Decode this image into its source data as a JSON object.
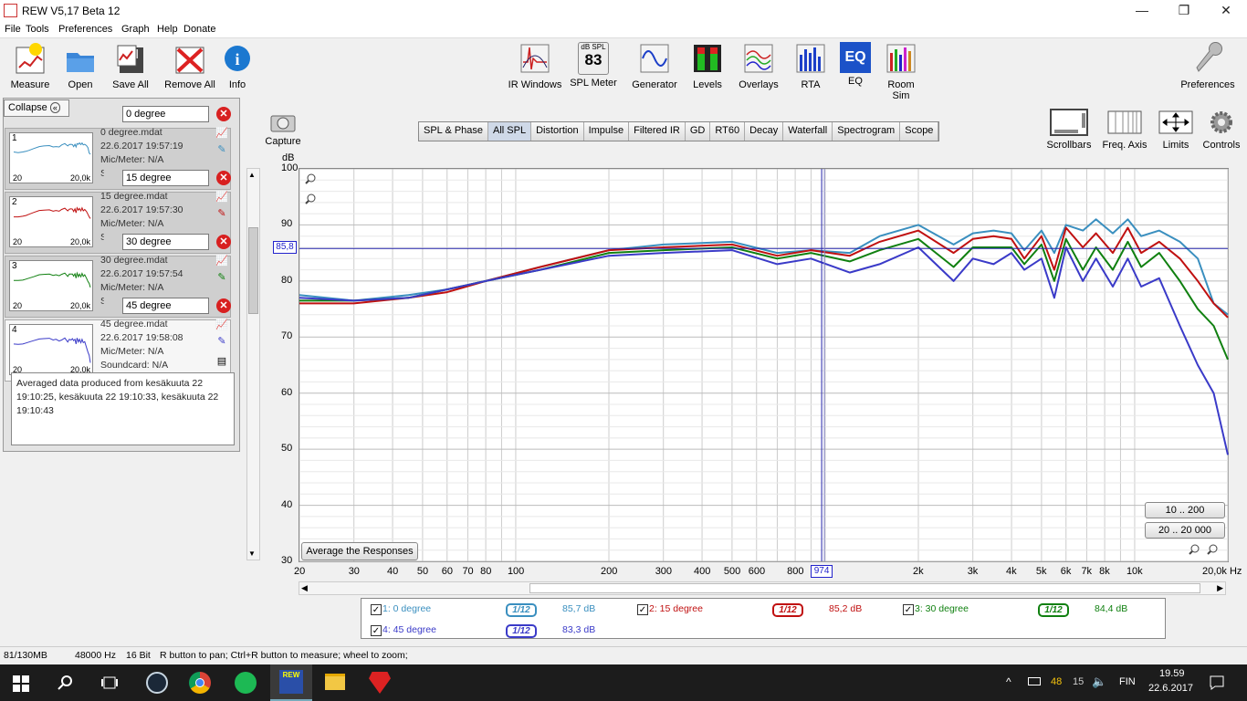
{
  "window": {
    "title": "REW V5,17 Beta 12",
    "min": "—",
    "max": "❐",
    "close": "✕"
  },
  "menu": [
    "File",
    "Tools",
    "Preferences",
    "Graph",
    "Help",
    "Donate"
  ],
  "toolbar": {
    "measure": "Measure",
    "open": "Open",
    "save_all": "Save All",
    "remove_all": "Remove All",
    "info": "Info",
    "ir_windows": "IR Windows",
    "spl_meter": "SPL Meter",
    "spl_meter_icon_label": "dB SPL",
    "spl_meter_value": "83",
    "generator": "Generator",
    "levels": "Levels",
    "overlays": "Overlays",
    "rta": "RTA",
    "eq": "EQ",
    "eq_icon_label": "EQ",
    "room_sim": "Room Sim",
    "preferences": "Preferences",
    "capture": "Capture",
    "scrollbars": "Scrollbars",
    "freq_axis": "Freq. Axis",
    "limits": "Limits",
    "controls": "Controls"
  },
  "tabs": [
    "SPL & Phase",
    "All SPL",
    "Distortion",
    "Impulse",
    "Filtered IR",
    "GD",
    "RT60",
    "Decay",
    "Waterfall",
    "Spectrogram",
    "Scope"
  ],
  "left": {
    "collapse": "Collapse",
    "measurements": [
      {
        "num": "1",
        "name": "0 degree",
        "file": "0 degree.mdat",
        "date": "22.6.2017 19:57:19",
        "mic": "Mic/Meter: N/A",
        "sc": "Soundcard: N/A",
        "color": "#3a8fbf"
      },
      {
        "num": "2",
        "name": "15 degree",
        "file": "15 degree.mdat",
        "date": "22.6.2017 19:57:30",
        "mic": "Mic/Meter: N/A",
        "sc": "Soundcard: N/A",
        "color": "#c01010"
      },
      {
        "num": "3",
        "name": "30 degree",
        "file": "30 degree.mdat",
        "date": "22.6.2017 19:57:54",
        "mic": "Mic/Meter: N/A",
        "sc": "Soundcard: N/A",
        "color": "#108010"
      },
      {
        "num": "4",
        "name": "45 degree",
        "file": "45 degree.mdat",
        "date": "22.6.2017 19:58:08",
        "mic": "Mic/Meter: N/A",
        "sc": "Soundcard: N/A",
        "color": "#3a3ac8"
      }
    ],
    "thumb_x_start": "20",
    "thumb_x_end": "20,0k",
    "notes": "Averaged data produced from kesäkuuta 22 19:10:25, kesäkuuta 22 19:10:33, kesäkuuta 22 19:10:43"
  },
  "graph": {
    "unit": "dB",
    "cursor_db": "85,8",
    "cursor_freq": "974",
    "freq_unit": "Hz",
    "average_button": "Average the Responses",
    "range_a": "10 .. 200",
    "range_b": "20 .. 20 000"
  },
  "legend": [
    {
      "label": "1: 0 degree",
      "smooth": "1/12",
      "value": "85,7 dB",
      "color": "#3a8fbf",
      "checked": "✓"
    },
    {
      "label": "2: 15 degree",
      "smooth": "1/12",
      "value": "85,2 dB",
      "color": "#c01010",
      "checked": "✓"
    },
    {
      "label": "3: 30 degree",
      "smooth": "1/12",
      "value": "84,4 dB",
      "color": "#108010",
      "checked": "✓"
    },
    {
      "label": "4: 45 degree",
      "smooth": "1/12",
      "value": "83,3 dB",
      "color": "#3a3ac8",
      "checked": "✓"
    }
  ],
  "status": {
    "memory": "81/130MB",
    "rate": "48000 Hz",
    "bits": "16 Bit",
    "hint": "R button to pan; Ctrl+R button to measure; wheel to zoom;"
  },
  "taskbar": {
    "time": "19.59",
    "date": "22.6.2017",
    "lang": "FIN",
    "battery": "48",
    "tray_num": "15",
    "rew_label": "REW"
  },
  "chart_data": {
    "type": "line",
    "xscale": "log",
    "xlim": [
      20,
      20000
    ],
    "ylim": [
      30,
      100
    ],
    "ylabel": "dB",
    "yticks": [
      30,
      40,
      50,
      60,
      70,
      80,
      90,
      100
    ],
    "xticks": [
      [
        20,
        "20"
      ],
      [
        30,
        "30"
      ],
      [
        40,
        "40"
      ],
      [
        50,
        "50"
      ],
      [
        60,
        "60"
      ],
      [
        70,
        "70"
      ],
      [
        80,
        "80"
      ],
      [
        100,
        "100"
      ],
      [
        200,
        "200"
      ],
      [
        300,
        "300"
      ],
      [
        400,
        "400"
      ],
      [
        500,
        "500"
      ],
      [
        600,
        "600"
      ],
      [
        800,
        "800"
      ],
      [
        2000,
        "2k"
      ],
      [
        3000,
        "3k"
      ],
      [
        4000,
        "4k"
      ],
      [
        5000,
        "5k"
      ],
      [
        6000,
        "6k"
      ],
      [
        7000,
        "7k"
      ],
      [
        8000,
        "8k"
      ],
      [
        10000,
        "10k"
      ],
      [
        20000,
        "20,0k Hz"
      ]
    ],
    "cursor": {
      "x": 974,
      "y": 85.8
    },
    "series": [
      {
        "name": "1: 0 degree",
        "color": "#3a8fbf",
        "x": [
          20,
          30,
          45,
          60,
          80,
          120,
          200,
          300,
          500,
          700,
          900,
          1200,
          1500,
          2000,
          2600,
          3000,
          3500,
          4000,
          4400,
          5000,
          5500,
          6000,
          6800,
          7500,
          8500,
          9500,
          10500,
          12000,
          14000,
          16000,
          18000,
          20000
        ],
        "y": [
          77.5,
          76.5,
          77.5,
          78.5,
          80,
          82.5,
          85.5,
          86.5,
          87,
          85,
          85.5,
          85,
          88,
          90,
          86.5,
          88.5,
          89,
          88.5,
          85.5,
          89,
          85,
          90,
          89,
          91,
          88.5,
          91,
          88,
          89,
          87,
          84,
          76,
          74
        ]
      },
      {
        "name": "2: 15 degree",
        "color": "#c01010",
        "x": [
          20,
          30,
          45,
          60,
          80,
          120,
          200,
          300,
          500,
          700,
          900,
          1200,
          1500,
          2000,
          2600,
          3000,
          3500,
          4000,
          4400,
          5000,
          5500,
          6000,
          6800,
          7500,
          8500,
          9500,
          10500,
          12000,
          14000,
          16000,
          18000,
          20000
        ],
        "y": [
          76,
          76,
          77,
          78,
          80,
          82.5,
          85.5,
          86,
          86.5,
          84.5,
          85.5,
          84.5,
          87,
          89,
          85,
          87.5,
          88,
          87.5,
          84,
          88,
          82,
          89.5,
          86,
          88.5,
          85,
          89.5,
          85,
          87,
          84,
          80,
          76,
          73.5
        ]
      },
      {
        "name": "3: 30 degree",
        "color": "#108010",
        "x": [
          20,
          30,
          45,
          60,
          80,
          120,
          200,
          300,
          500,
          700,
          900,
          1200,
          1500,
          2000,
          2600,
          3000,
          3500,
          4000,
          4400,
          5000,
          5500,
          6000,
          6800,
          7500,
          8500,
          9500,
          10500,
          12000,
          14000,
          16000,
          18000,
          20000
        ],
        "y": [
          76.5,
          76.5,
          77,
          78.5,
          80,
          82,
          85,
          85.5,
          86,
          84,
          85,
          83.5,
          85.5,
          87.5,
          82.5,
          86,
          86,
          86,
          83,
          86.5,
          80,
          87.5,
          82,
          86,
          82,
          87,
          82.5,
          85,
          80,
          75,
          72,
          66
        ]
      },
      {
        "name": "4: 45 degree",
        "color": "#3a3ac8",
        "x": [
          20,
          30,
          45,
          60,
          80,
          120,
          200,
          300,
          500,
          700,
          900,
          1200,
          1500,
          2000,
          2600,
          3000,
          3500,
          4000,
          4400,
          5000,
          5500,
          6000,
          6800,
          7500,
          8500,
          9500,
          10500,
          12000,
          14000,
          16000,
          18000,
          20000
        ],
        "y": [
          77,
          76.5,
          77,
          78.5,
          80,
          82,
          84.5,
          85,
          85.5,
          83,
          84,
          81.5,
          83,
          86,
          80,
          84,
          83,
          85,
          82,
          84,
          77,
          86,
          80,
          84,
          79,
          84,
          79,
          80.5,
          72,
          65,
          60,
          49
        ]
      }
    ]
  }
}
